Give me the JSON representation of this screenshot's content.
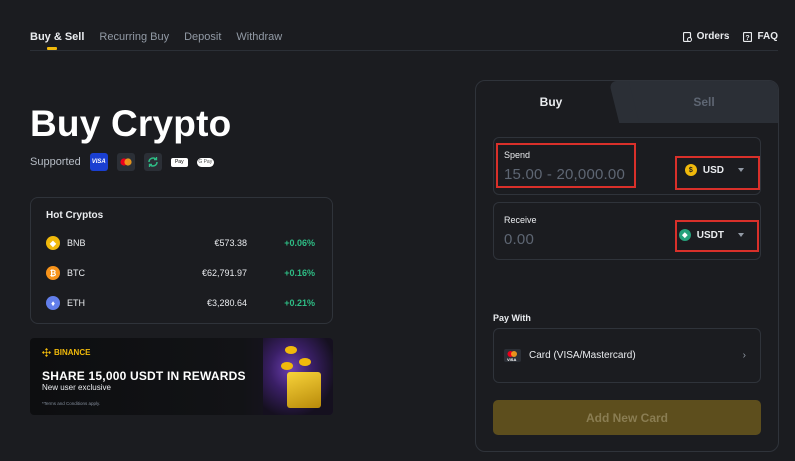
{
  "nav": {
    "tabs": [
      "Buy & Sell",
      "Recurring Buy",
      "Deposit",
      "Withdraw"
    ],
    "orders_label": "Orders",
    "faq_label": "FAQ"
  },
  "hero": {
    "title": "Buy Crypto",
    "supported_label": "Supported",
    "payment_icons": [
      "visa-icon",
      "mastercard-icon",
      "refresh-icon",
      "apple-pay-icon",
      "google-pay-icon"
    ],
    "visa_text": "VISA",
    "apple_pay_text": "Pay",
    "google_pay_text": "G Pay"
  },
  "hot": {
    "title": "Hot Cryptos",
    "rows": [
      {
        "symbol": "BNB",
        "price": "€573.38",
        "change": "+0.06%",
        "color": "#f0b90b"
      },
      {
        "symbol": "BTC",
        "price": "€62,791.97",
        "change": "+0.16%",
        "color": "#f7931a"
      },
      {
        "symbol": "ETH",
        "price": "€3,280.64",
        "change": "+0.21%",
        "color": "#627eea"
      }
    ]
  },
  "banner": {
    "brand": "BINANCE",
    "title": "SHARE 15,000 USDT IN REWARDS",
    "subtitle": "New user exclusive",
    "terms": "*Terms and Conditions apply."
  },
  "trade": {
    "buy_tab": "Buy",
    "sell_tab": "Sell",
    "spend": {
      "label": "Spend",
      "placeholder": "15.00 - 20,000.00",
      "currency": "USD",
      "currency_icon": "$"
    },
    "receive": {
      "label": "Receive",
      "placeholder": "0.00",
      "currency": "USDT",
      "currency_icon": "◆"
    },
    "pay_with_label": "Pay With",
    "pay_method": "Card (VISA/Mastercard)",
    "pay_card_text": "VISA",
    "add_card_button": "Add New Card"
  },
  "colors": {
    "accent": "#f0b90b",
    "positive": "#2ebd85",
    "highlight_box": "#d9302a"
  }
}
